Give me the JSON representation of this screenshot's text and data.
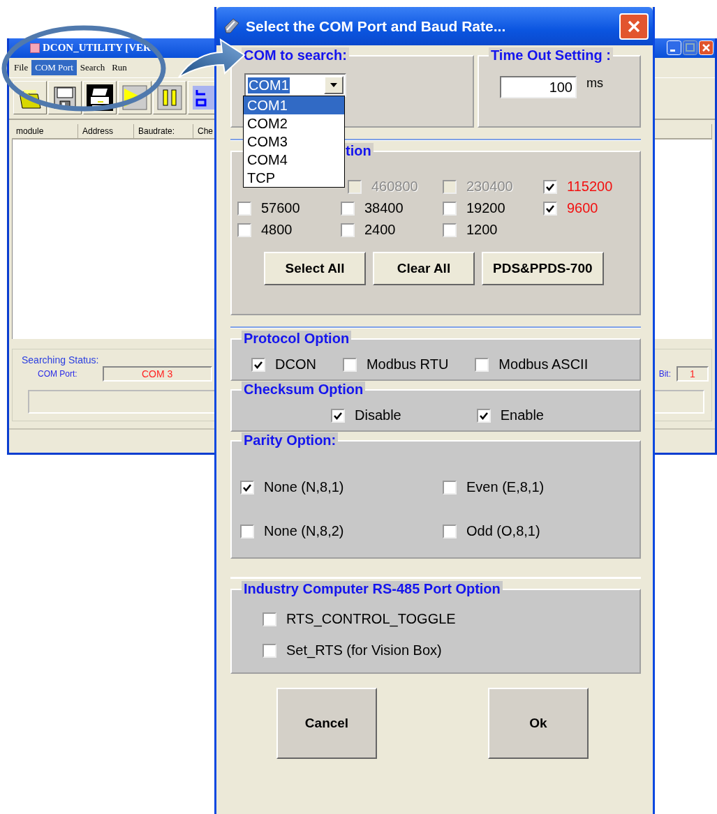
{
  "main_window": {
    "title": "DCON_UTILITY [VER",
    "menu": [
      {
        "label": "File",
        "selected": false
      },
      {
        "label": "COM Port",
        "selected": true
      },
      {
        "label": "Search",
        "selected": false
      },
      {
        "label": "Run",
        "selected": false
      }
    ],
    "toolbar": [
      {
        "kind": "folder"
      },
      {
        "kind": "save"
      },
      {
        "kind": "printer"
      },
      {
        "kind": "play"
      },
      {
        "kind": "pause"
      },
      {
        "kind": "grid"
      }
    ],
    "columns": [
      "module",
      "Address",
      "Baudrate:",
      "Che"
    ],
    "status_group": {
      "title": "Searching Status:",
      "com_port_label": "COM Port:",
      "com_port_value": "COM 3",
      "stop_bit_label": "Bit:",
      "stop_bit_value": "1"
    }
  },
  "dialog": {
    "title": "Select the COM Port and Baud Rate...",
    "com_group": {
      "title": "COM to search:",
      "value": "COM1",
      "options": [
        {
          "label": "COM1",
          "selected": true
        },
        {
          "label": "COM2",
          "selected": false
        },
        {
          "label": "COM3",
          "selected": false
        },
        {
          "label": "COM4",
          "selected": false
        },
        {
          "label": "TCP",
          "selected": false
        }
      ]
    },
    "timeout_group": {
      "title": "Time Out Setting :",
      "value": "100",
      "unit": "ms"
    },
    "baud_group": {
      "title": "tion",
      "items": [
        {
          "label": "460800",
          "checked": false,
          "disabled": true
        },
        {
          "label": "230400",
          "checked": false,
          "disabled": true
        },
        {
          "label": "115200",
          "checked": true,
          "disabled": false
        },
        {
          "label": "57600",
          "checked": false,
          "disabled": false
        },
        {
          "label": "38400",
          "checked": false,
          "disabled": false
        },
        {
          "label": "19200",
          "checked": false,
          "disabled": false
        },
        {
          "label": "9600",
          "checked": true,
          "disabled": false
        },
        {
          "label": "4800",
          "checked": false,
          "disabled": false
        },
        {
          "label": "2400",
          "checked": false,
          "disabled": false
        },
        {
          "label": "1200",
          "checked": false,
          "disabled": false
        }
      ],
      "buttons": [
        "Select All",
        "Clear All",
        "PDS&PPDS-700"
      ]
    },
    "protocol_group": {
      "title": "Protocol Option",
      "items": [
        {
          "label": "DCON",
          "checked": true
        },
        {
          "label": "Modbus RTU",
          "checked": false
        },
        {
          "label": "Modbus ASCII",
          "checked": false
        }
      ]
    },
    "checksum_group": {
      "title": "Checksum  Option",
      "items": [
        {
          "label": "Disable",
          "checked": true
        },
        {
          "label": "Enable",
          "checked": true
        }
      ]
    },
    "parity_group": {
      "title": "Parity Option:",
      "items": [
        {
          "label": "None  (N,8,1)",
          "checked": true
        },
        {
          "label": "Even  (E,8,1)",
          "checked": false
        },
        {
          "label": "None (N,8,2)",
          "checked": false
        },
        {
          "label": "Odd  (O,8,1)",
          "checked": false
        }
      ]
    },
    "rs485_group": {
      "title": "Industry Computer RS-485 Port Option",
      "items": [
        {
          "label": "RTS_CONTROL_TOGGLE",
          "checked": false
        },
        {
          "label": "Set_RTS (for Vision Box)",
          "checked": false
        }
      ]
    },
    "buttons": [
      "Cancel",
      "Ok"
    ]
  }
}
